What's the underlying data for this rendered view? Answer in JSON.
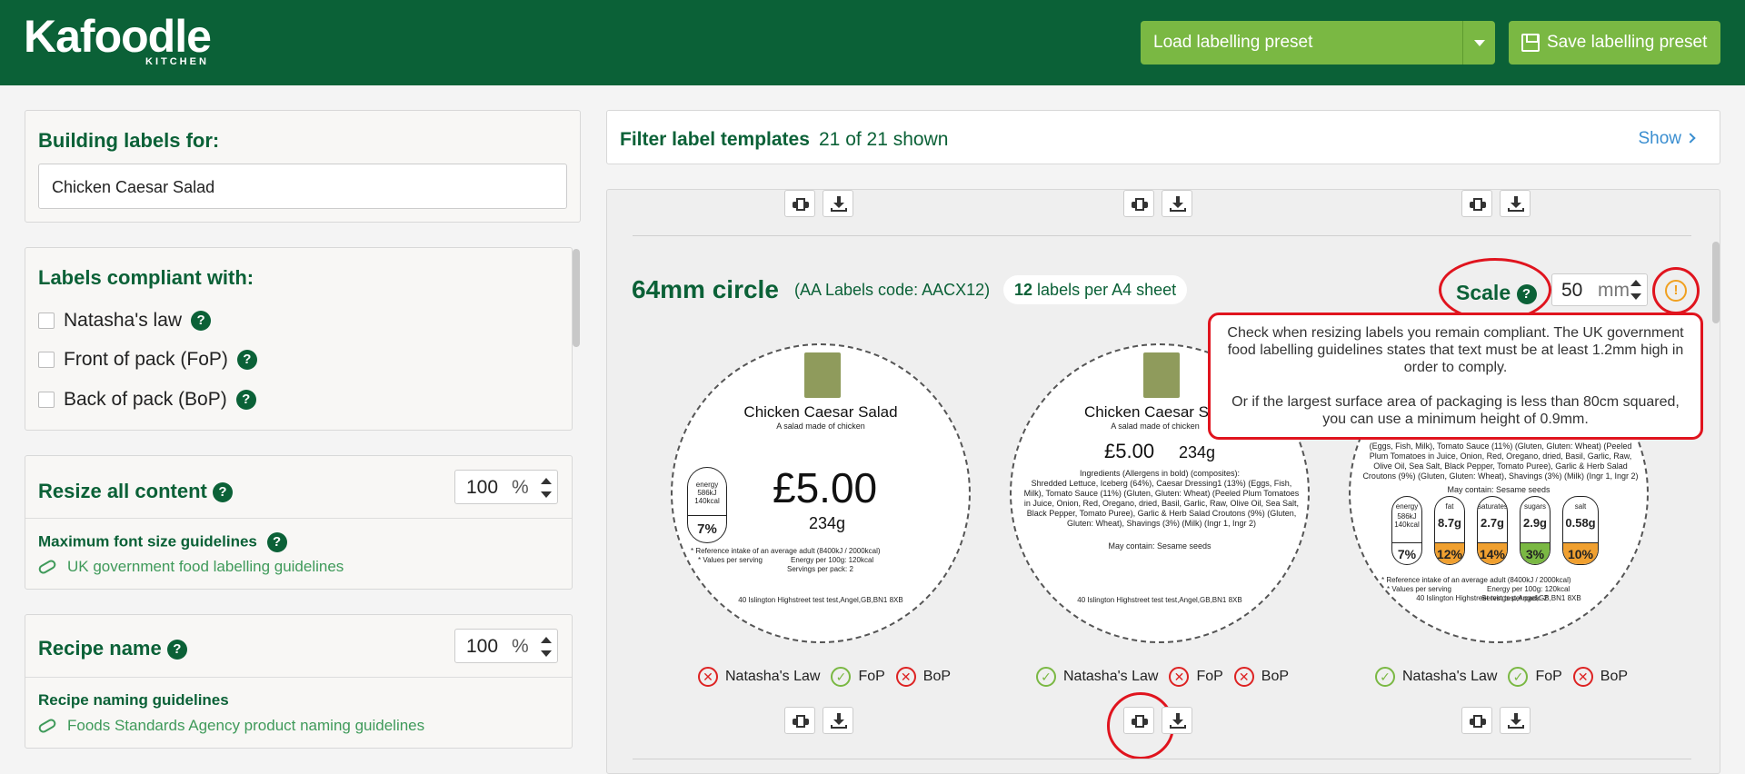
{
  "header": {
    "logo_main": "Kafoodle",
    "logo_sub": "KITCHEN",
    "load_preset_label": "Load labelling preset",
    "save_preset_label": "Save labelling preset"
  },
  "building": {
    "title": "Building labels for:",
    "recipe_value": "Chicken Caesar Salad"
  },
  "compliance_panel": {
    "title": "Labels compliant with:",
    "options": [
      "Natasha's law",
      "Front of pack (FoP)",
      "Back of pack (BoP)"
    ]
  },
  "resize": {
    "title": "Resize all content",
    "value": "100",
    "unit": "%",
    "guide_title": "Maximum font size guidelines",
    "guide_link": "UK government food labelling guidelines"
  },
  "recipe_name": {
    "title": "Recipe name",
    "value": "100",
    "unit": "%",
    "guide_title": "Recipe naming guidelines",
    "guide_link": "Foods Standards Agency product naming guidelines"
  },
  "filter": {
    "title": "Filter label templates",
    "count": "21 of 21 shown",
    "show_label": "Show"
  },
  "template": {
    "title": "64mm circle",
    "code": "(AA Labels code: AACX12)",
    "per_sheet_num": "12",
    "per_sheet_text": "labels per A4 sheet",
    "scale_label": "Scale",
    "scale_value": "50",
    "scale_unit": "mm",
    "warn_icon": "!",
    "tooltip_p1": "Check when resizing labels you remain compliant. The UK government food labelling guidelines states that text must be at least 1.2mm high in order to comply.",
    "tooltip_p2": "Or if the largest surface area of packaging is less than 80cm squared, you can use a minimum height of 0.9mm."
  },
  "labels": [
    {
      "name": "Chicken Caesar Salad",
      "desc": "A salad made of chicken",
      "price": "£5.00",
      "weight": "234g",
      "energy_label": "energy",
      "energy_kj": "586kJ",
      "energy_kcal": "140kcal",
      "energy_pct": "7%",
      "ref_note": "* Reference intake of an average adult (8400kJ / 2000kcal)",
      "values_note": "* Values per serving",
      "per100": "Energy per 100g: 120kcal",
      "servings": "Servings per pack: 2",
      "address": "40 Islington Highstreet test test,Angel,GB,BN1 8XB",
      "compliance": [
        {
          "label": "Natasha's Law",
          "ok": false
        },
        {
          "label": "FoP",
          "ok": true
        },
        {
          "label": "BoP",
          "ok": false
        }
      ]
    },
    {
      "name": "Chicken Caesar S",
      "desc": "A salad made of chicken",
      "price": "£5.00",
      "weight": "234g",
      "ingredients_head": "Ingredients (Allergens in bold) (composites):",
      "ingredients": "Shredded Lettuce, Iceberg (64%), Caesar Dressing1 (13%) (Eggs, Fish, Milk), Tomato Sauce (11%) (Gluten, Gluten: Wheat) (Peeled Plum Tomatoes in Juice, Onion, Red, Oregano, dried, Basil, Garlic, Raw, Olive Oil, Sea Salt, Black Pepper, Tomato Puree), Garlic & Herb Salad Croutons (9%) (Gluten, Gluten: Wheat), Shavings (3%) (Milk) (Ingr 1, Ingr 2)",
      "may_contain": "May contain: Sesame seeds",
      "address": "40 Islington Highstreet test test,Angel,GB,BN1 8XB",
      "compliance": [
        {
          "label": "Natasha's Law",
          "ok": true
        },
        {
          "label": "FoP",
          "ok": false
        },
        {
          "label": "BoP",
          "ok": false
        }
      ]
    },
    {
      "ingredients": "(Eggs, Fish, Milk), Tomato Sauce (11%) (Gluten, Gluten: Wheat) (Peeled Plum Tomatoes in Juice, Onion, Red, Oregano, dried, Basil, Garlic, Raw, Olive Oil, Sea Salt, Black Pepper, Tomato Puree), Garlic & Herb Salad Croutons (9%) (Gluten, Gluten: Wheat), Shavings (3%) (Milk) (Ingr 1, Ingr 2)",
      "may_contain": "May contain: Sesame seeds",
      "nutrients": [
        {
          "name": "energy",
          "value": "586kJ 140kcal",
          "pct": "7%",
          "color": "#ffffff"
        },
        {
          "name": "fat",
          "value": "8.7g",
          "pct": "12%",
          "color": "#f0a030"
        },
        {
          "name": "saturates",
          "value": "2.7g",
          "pct": "14%",
          "color": "#f0a030"
        },
        {
          "name": "sugars",
          "value": "2.9g",
          "pct": "3%",
          "color": "#7ab843"
        },
        {
          "name": "salt",
          "value": "0.58g",
          "pct": "10%",
          "color": "#f0a030"
        }
      ],
      "ref_note": "* Reference intake of an average adult (8400kJ / 2000kcal)",
      "values_note": "* Values per serving",
      "per100": "Energy per 100g: 120kcal",
      "servings": "Servings per pack: 2",
      "address": "40 Islington Highstreet test test,Angel,GB,BN1 8XB",
      "compliance": [
        {
          "label": "Natasha's Law",
          "ok": true
        },
        {
          "label": "FoP",
          "ok": true
        },
        {
          "label": "BoP",
          "ok": false
        }
      ]
    }
  ],
  "colors": {
    "brand_green": "#0b6137",
    "accent_green": "#7ab843",
    "highlight_red": "#e0141e",
    "link_blue": "#3a8ed0"
  }
}
